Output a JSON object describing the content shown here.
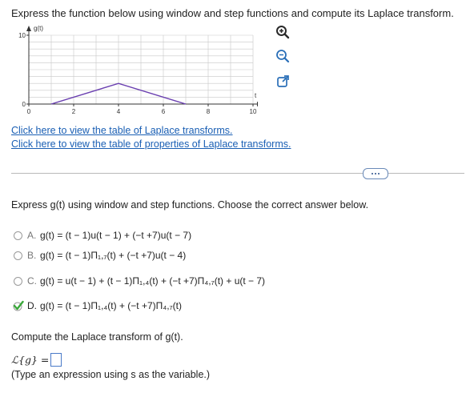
{
  "prompt": "Express the function below using window and step functions and compute its Laplace transform.",
  "graph": {
    "y_axis_label": "g(t)",
    "x_axis_label": "t",
    "y_ticks": [
      "10",
      "0"
    ],
    "x_ticks": [
      "0",
      "2",
      "4",
      "6",
      "8",
      "10"
    ],
    "series_points": [
      [
        1,
        0
      ],
      [
        4,
        3
      ],
      [
        7,
        0
      ]
    ],
    "y_range": [
      0,
      10
    ],
    "x_range": [
      0,
      10
    ],
    "grid": true,
    "line_color": "#6a3fb0"
  },
  "toolbar": {
    "zoom_in_icon": "zoom-in-icon",
    "zoom_out_icon": "zoom-out-icon",
    "popout_icon": "popout-icon"
  },
  "links": {
    "laplace_table": "Click here to view the table of Laplace transforms.",
    "properties_table": "Click here to view the table of properties of Laplace transforms."
  },
  "question": "Express g(t) using window and step functions. Choose the correct answer below.",
  "options": [
    {
      "letter": "A.",
      "expr": "g(t) = (t − 1)u(t − 1) + (−t +7)u(t − 7)",
      "selected": false
    },
    {
      "letter": "B.",
      "expr": "g(t) = (t − 1)Π₁,₇(t) + (−t +7)u(t − 4)",
      "selected": false
    },
    {
      "letter": "C.",
      "expr": "g(t) = u(t − 1) + (t − 1)Π₁,₄(t) + (−t +7)Π₄,₇(t) + u(t − 7)",
      "selected": false
    },
    {
      "letter": "D.",
      "expr": "g(t) = (t − 1)Π₁,₄(t) + (−t +7)Π₄,₇(t)",
      "selected": true
    }
  ],
  "compute": "Compute the Laplace transform of g(t).",
  "answer": {
    "lhs": "ℒ{g} =",
    "value": ""
  },
  "hint": "(Type an expression using s as the variable.)",
  "colors": {
    "link": "#1a5fb4",
    "check": "#3aa83a",
    "accent_border": "#4a7ac8"
  }
}
